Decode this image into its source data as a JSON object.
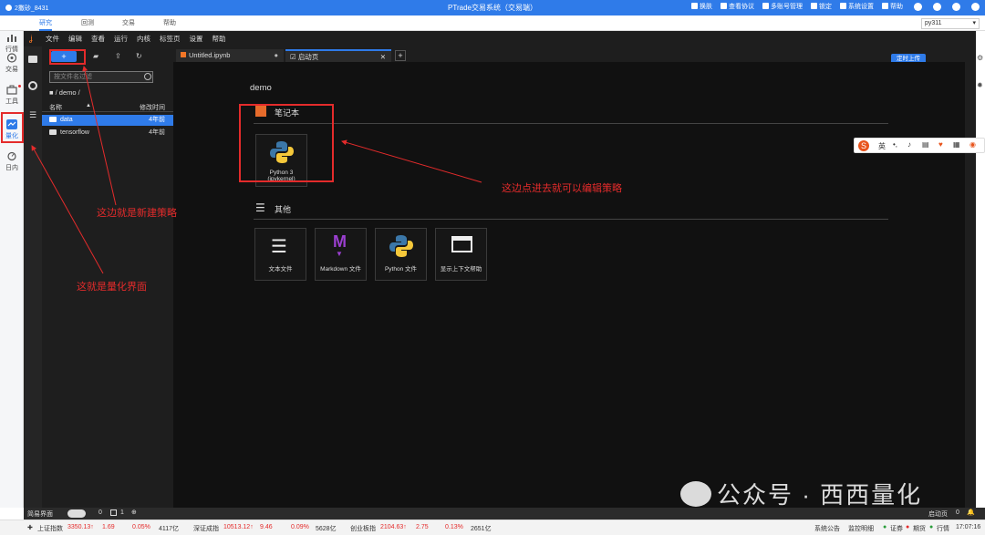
{
  "topbar": {
    "user": "2撒砂_8431",
    "title": "PTrade交易系统（交易端）",
    "links": [
      "换肤",
      "查看协议",
      "多账号管理",
      "锁定",
      "系统设置",
      "帮助"
    ]
  },
  "tabs": [
    "研究",
    "回测",
    "交易",
    "帮助"
  ],
  "env_select": "py311",
  "rail": [
    "行情",
    "交易",
    "工具",
    "量化",
    "日内"
  ],
  "menu": [
    "文件",
    "编辑",
    "查看",
    "运行",
    "内核",
    "标签页",
    "设置",
    "帮助"
  ],
  "filepanel": {
    "new_label": "+",
    "filter_placeholder": "按文件名过滤",
    "breadcrumb": "■ / demo /",
    "col_name": "名称",
    "col_modified": "修改时间",
    "rows": [
      {
        "name": "data",
        "date": "4年前"
      },
      {
        "name": "tensorflow",
        "date": "4年前"
      }
    ]
  },
  "editor_tabs": [
    {
      "label": "Untitled.ipynb"
    },
    {
      "label": "启动页"
    }
  ],
  "upload_label": "定时上传",
  "launcher": {
    "folder": "demo",
    "notebook_title": "笔记本",
    "notebook_card": "Python 3 (ipykernel)",
    "other_title": "其他",
    "other_cards": [
      "文本文件",
      "Markdown 文件",
      "Python 文件",
      "显示上下文帮助"
    ]
  },
  "annotations": {
    "new_strategy": "这边就是新建策略",
    "quant_ui": "这就是量化界面",
    "edit_strategy": "这边点进去就可以编辑策略"
  },
  "bottombar": {
    "simple": "简易界面",
    "count_a": "0",
    "count_b": "1",
    "launch": "启动页",
    "count_c": "0"
  },
  "statusbar": {
    "indices": [
      {
        "name": "上证指数",
        "value": "3350.13↑",
        "chg": "1.69",
        "pct": "0.05%",
        "vol": "4117亿"
      },
      {
        "name": "深证成指",
        "value": "10513.12↑",
        "chg": "9.46",
        "pct": "0.09%",
        "vol": "5628亿"
      },
      {
        "name": "创业板指",
        "value": "2104.63↑",
        "chg": "2.75",
        "pct": "0.13%",
        "vol": "2651亿"
      }
    ],
    "right": [
      "系统公告",
      "监控明细",
      "证券",
      "期货",
      "行情"
    ],
    "time": "17:07:16"
  },
  "ime": {
    "label": "英"
  },
  "watermark": "公众号 · 西西量化",
  "colors": {
    "accent": "#2f7be9",
    "annot": "#e42b2b",
    "dark": "#2b2b2b"
  }
}
